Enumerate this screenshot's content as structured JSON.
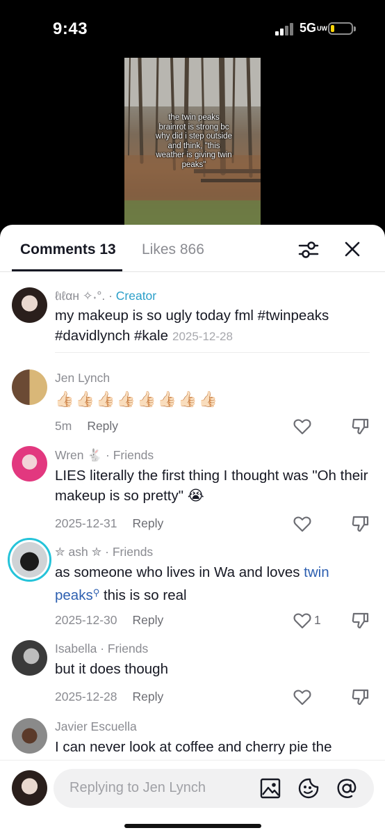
{
  "status_bar": {
    "time": "9:43",
    "network": "5G",
    "network_suffix": "UW",
    "battery_level": 0.18,
    "battery_color": "#ffd60a"
  },
  "video": {
    "caption": "the twin peaks brainrot is strong bc why did i step outside and think, \"this weather is giving twin peaks\""
  },
  "tabs": {
    "comments": "Comments 13",
    "likes": "Likes 866",
    "filter_icon": "filter-sliders-icon",
    "close_icon": "close-icon"
  },
  "colors": {
    "creator": "#2b9fc9",
    "hashtag_link": "#2d5fb0",
    "secondary_text": "#8a8b91"
  },
  "comments": [
    {
      "author": "ℓιℓαн ✧˖°.",
      "tag": "Creator",
      "text": "my makeup is so ugly today fml #twinpeaks #davidlynch #kale",
      "date": "2025-12-28"
    },
    {
      "author": "Jen Lynch",
      "text": "👍🏻👍🏻👍🏻👍🏻👍🏻👍🏻👍🏻👍🏻",
      "date": "5m",
      "reply": "Reply"
    },
    {
      "author": "Wren 🐇",
      "tag": "Friends",
      "text": "LIES literally the first thing I thought was \"Oh their makeup is so pretty\" 😭",
      "date": "2025-12-31",
      "reply": "Reply"
    },
    {
      "author": "✮ ash ✮",
      "tag": "Friends",
      "text_before": "as someone who lives in Wa and loves ",
      "link": "twin peaks",
      "text_after": " this is so real",
      "date": "2025-12-30",
      "reply": "Reply",
      "likes": "1"
    },
    {
      "author": "Isabella",
      "tag": "Friends",
      "text": "but it does though",
      "date": "2025-12-28",
      "reply": "Reply"
    },
    {
      "author": "Javier Escuella",
      "text": "I can never look at coffee and cherry pie the"
    }
  ],
  "reply_bar": {
    "placeholder": "Replying to Jen Lynch",
    "icons": [
      "image-icon",
      "sticker-icon",
      "mention-icon"
    ]
  },
  "separator": " · "
}
